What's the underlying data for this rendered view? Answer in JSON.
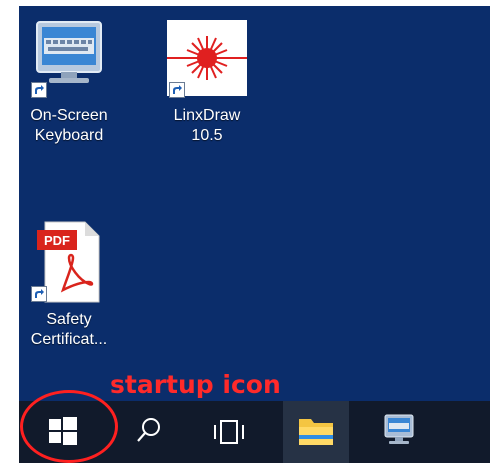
{
  "desktop": {
    "background_color": "#0b2d6b",
    "icons": [
      {
        "label": "On-Screen\nKeyboard",
        "icon": "on-screen-keyboard-icon"
      },
      {
        "label": "LinxDraw 10.5",
        "icon": "linxdraw-icon"
      },
      {
        "label": "Safety\nCertificat...",
        "icon": "pdf-document-icon",
        "badge": "PDF"
      }
    ]
  },
  "annotation": {
    "text": "startup icon",
    "color": "#ff2a2a"
  },
  "taskbar": {
    "buttons": [
      {
        "name": "start-button",
        "icon": "windows-logo-icon"
      },
      {
        "name": "search-button",
        "icon": "search-icon"
      },
      {
        "name": "task-view-button",
        "icon": "task-view-icon"
      },
      {
        "name": "file-explorer-button",
        "icon": "folder-icon"
      },
      {
        "name": "on-screen-keyboard-taskbar-button",
        "icon": "on-screen-keyboard-icon"
      }
    ]
  }
}
